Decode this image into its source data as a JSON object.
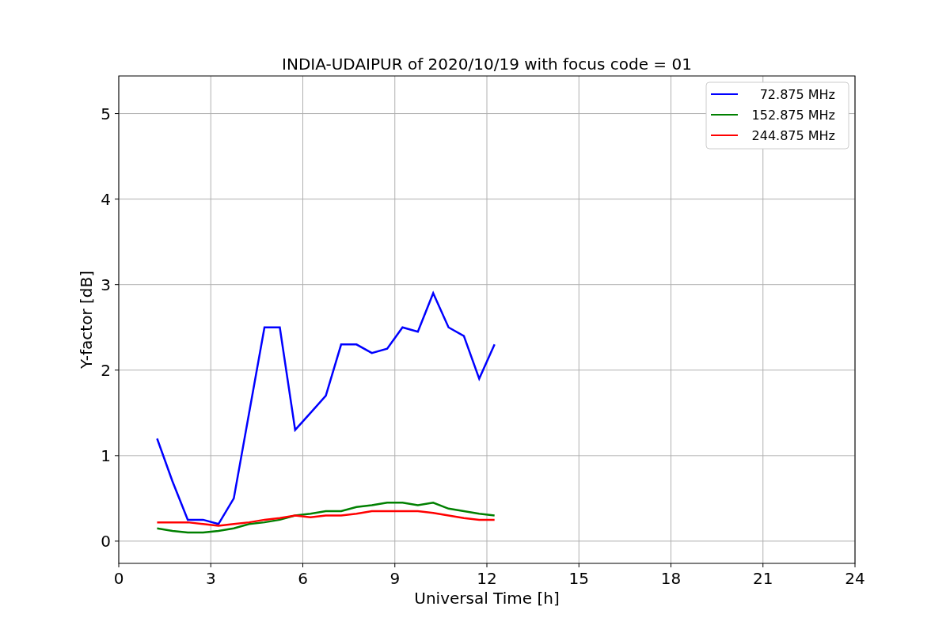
{
  "chart_data": {
    "type": "line",
    "title": "INDIA-UDAIPUR of 2020/10/19 with focus code = 01",
    "xlabel": "Universal Time [h]",
    "ylabel": "Y-factor [dB]",
    "x": [
      1.25,
      1.75,
      2.25,
      2.75,
      3.25,
      3.75,
      4.25,
      4.75,
      5.25,
      5.75,
      6.25,
      6.75,
      7.25,
      7.75,
      8.25,
      8.75,
      9.25,
      9.75,
      10.25,
      10.75,
      11.25,
      11.75,
      12.25
    ],
    "series": [
      {
        "name": "72.875 MHz",
        "color": "#0000ff",
        "values": [
          1.2,
          0.7,
          0.25,
          0.25,
          0.2,
          0.5,
          1.5,
          2.5,
          2.5,
          1.3,
          1.5,
          1.7,
          2.3,
          2.3,
          2.2,
          2.25,
          2.5,
          2.45,
          2.9,
          2.5,
          2.4,
          1.9,
          2.3
        ]
      },
      {
        "name": "152.875 MHz",
        "color": "#008000",
        "values": [
          0.15,
          0.12,
          0.1,
          0.1,
          0.12,
          0.15,
          0.2,
          0.22,
          0.25,
          0.3,
          0.32,
          0.35,
          0.35,
          0.4,
          0.42,
          0.45,
          0.45,
          0.42,
          0.45,
          0.38,
          0.35,
          0.32,
          0.3
        ]
      },
      {
        "name": "244.875 MHz",
        "color": "#ff0000",
        "values": [
          0.22,
          0.22,
          0.22,
          0.2,
          0.18,
          0.2,
          0.22,
          0.25,
          0.27,
          0.3,
          0.28,
          0.3,
          0.3,
          0.32,
          0.35,
          0.35,
          0.35,
          0.35,
          0.33,
          0.3,
          0.27,
          0.25,
          0.25
        ]
      }
    ],
    "xlim": [
      0,
      24
    ],
    "ylim": [
      -0.26,
      5.44
    ],
    "xticks": [
      0,
      3,
      6,
      9,
      12,
      15,
      18,
      21,
      24
    ],
    "yticks": [
      0,
      1,
      2,
      3,
      4,
      5
    ],
    "grid": true,
    "legend": true
  }
}
